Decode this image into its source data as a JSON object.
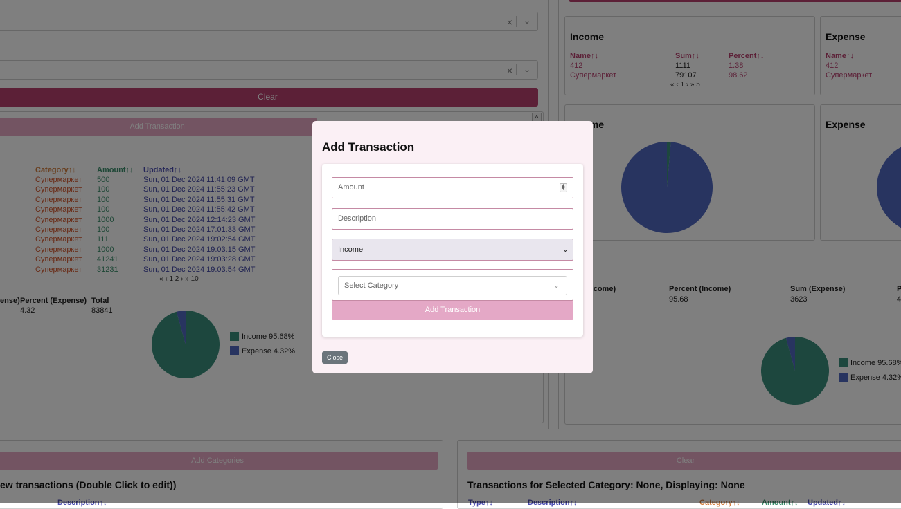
{
  "colors": {
    "accent": "#b8416f",
    "accent_soft": "#e6a9c5",
    "income": "#3a8f7d",
    "expense": "#5068c0",
    "modal_bg": "#fbf0f5",
    "overlay": "rgba(0,0,0,0.5)"
  },
  "left": {
    "clear_label": "Clear",
    "add_transaction_label": "Add Transaction",
    "table": {
      "headers": {
        "category": "Category↑↓",
        "amount": "Amount↑↓",
        "updated": "Updated↑↓"
      },
      "rows": [
        {
          "category": "Супермаркет",
          "amount": "500",
          "updated": "Sun, 01 Dec 2024 11:41:09 GMT"
        },
        {
          "category": "Супермаркет",
          "amount": "100",
          "updated": "Sun, 01 Dec 2024 11:55:23 GMT"
        },
        {
          "category": "Супермаркет",
          "amount": "100",
          "updated": "Sun, 01 Dec 2024 11:55:31 GMT"
        },
        {
          "category": "Супермаркет",
          "amount": "100",
          "updated": "Sun, 01 Dec 2024 11:55:42 GMT"
        },
        {
          "category": "Супермаркет",
          "amount": "1000",
          "updated": "Sun, 01 Dec 2024 12:14:23 GMT"
        },
        {
          "category": "Супермаркет",
          "amount": "100",
          "updated": "Sun, 01 Dec 2024 17:01:33 GMT"
        },
        {
          "category": "Супермаркет",
          "amount": "111",
          "updated": "Sun, 01 Dec 2024 19:02:54 GMT"
        },
        {
          "category": "Супермаркет",
          "amount": "1000",
          "updated": "Sun, 01 Dec 2024 19:03:15 GMT"
        },
        {
          "category": "Супермаркет",
          "amount": "41241",
          "updated": "Sun, 01 Dec 2024 19:03:28 GMT"
        },
        {
          "category": "Супермаркет",
          "amount": "31231",
          "updated": "Sun, 01 Dec 2024 19:03:54 GMT"
        }
      ],
      "pagination": "« ‹ 1 2 › » 10"
    },
    "summary": {
      "headers": {
        "partial": "ense)",
        "percent_expense": "Percent (Expense)",
        "total": "Total"
      },
      "values": {
        "percent_expense": "4.32",
        "total": "83841"
      }
    },
    "legend": {
      "income": "Income 95.68%",
      "expense": "Expense 4.32%"
    },
    "add_categories_label": "Add Categories",
    "bottom_heading": "ew transactions (Double Click to edit))",
    "bottom_col_description": "Description↑↓"
  },
  "right": {
    "income_card": {
      "title": "Income",
      "headers": {
        "name": "Name↑↓",
        "sum": "Sum↑↓",
        "percent": "Percent↑↓"
      },
      "rows": [
        {
          "name": "412",
          "sum": "1111",
          "percent": "1.38"
        },
        {
          "name": "Супермаркет",
          "sum": "79107",
          "percent": "98.62"
        }
      ],
      "pagination": "« ‹ 1 › » 5"
    },
    "expense_card": {
      "title": "Expense",
      "headers": {
        "name": "Name↑↓"
      },
      "rows": [
        {
          "name": "412"
        },
        {
          "name": "Супермаркет"
        }
      ]
    },
    "income_chart_title": "Income",
    "expense_chart_title": "Expense",
    "summary": {
      "headers": {
        "sum_income_partial": "ncome)",
        "percent_income": "Percent (Income)",
        "sum_expense": "Sum (Expense)",
        "p_partial": "P"
      },
      "values": {
        "percent_income": "95.68",
        "sum_expense": "3623",
        "partial": "4"
      }
    },
    "legend": {
      "income": "Income 95.68%",
      "expense": "Expense 4.32%"
    },
    "clear_label": "Clear",
    "bottom_heading": "Transactions for Selected Category: None, Displaying: None",
    "bottom_cols": {
      "type": "Type↑↓",
      "description": "Description↑↓",
      "category": "Category↑↓",
      "amount": "Amount↑↓",
      "updated": "Updated↑↓"
    }
  },
  "modal": {
    "title": "Add Transaction",
    "amount_placeholder": "Amount",
    "description_placeholder": "Description",
    "type_selected": "Income",
    "category_placeholder": "Select Category",
    "add_button": "Add Transaction",
    "close_button": "Close"
  },
  "chart_data": [
    {
      "type": "pie",
      "title": "",
      "categories": [
        "Income",
        "Expense"
      ],
      "values": [
        95.68,
        4.32
      ],
      "legend": "right"
    },
    {
      "type": "pie",
      "title": "Income",
      "categories": [
        "412",
        "Супермаркет"
      ],
      "values": [
        1.38,
        98.62
      ]
    }
  ]
}
